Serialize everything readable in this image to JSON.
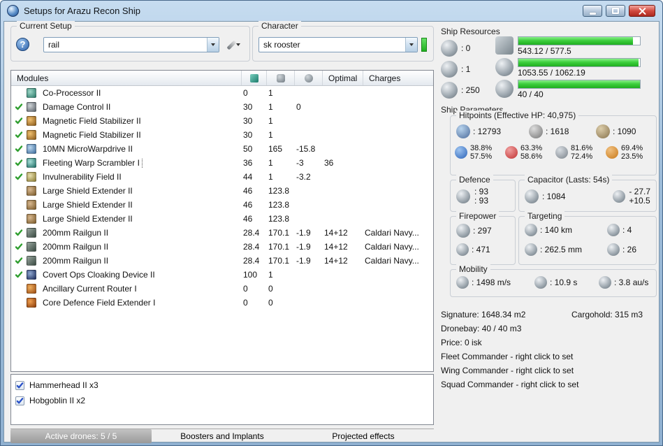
{
  "window": {
    "title": "Setups for Arazu Recon Ship"
  },
  "colors": {
    "progress_green": "#3ecf3e",
    "active_check_green": "#2f9e2f",
    "titlebar_blue": "#9dbcd9",
    "close_button_red": "#d24b40",
    "character_status_green": "#1faf1f"
  },
  "icons": {
    "help": "?"
  },
  "setup": {
    "group_label": "Current Setup",
    "selected": "rail"
  },
  "character": {
    "group_label": "Character",
    "selected": "sk rooster"
  },
  "modules": {
    "headers": {
      "name": "Modules",
      "optimal": "Optimal",
      "charges": "Charges"
    },
    "rows": [
      {
        "active": false,
        "icon": "coprocessor",
        "name": "Co-Processor II",
        "cpu": "0",
        "pg": "1",
        "cap": "",
        "optimal": "",
        "charges": ""
      },
      {
        "active": true,
        "icon": "damage-control",
        "name": "Damage Control II",
        "cpu": "30",
        "pg": "1",
        "cap": "0",
        "optimal": "",
        "charges": ""
      },
      {
        "active": true,
        "icon": "mag-stab",
        "name": "Magnetic Field Stabilizer II",
        "cpu": "30",
        "pg": "1",
        "cap": "",
        "optimal": "",
        "charges": ""
      },
      {
        "active": true,
        "icon": "mag-stab",
        "name": "Magnetic Field Stabilizer II",
        "cpu": "30",
        "pg": "1",
        "cap": "",
        "optimal": "",
        "charges": ""
      },
      {
        "active": true,
        "icon": "mwd",
        "name": "10MN MicroWarpdrive II",
        "cpu": "50",
        "pg": "165",
        "cap": "-15.8",
        "optimal": "",
        "charges": ""
      },
      {
        "active": true,
        "selected": true,
        "icon": "scrambler",
        "name": "Fleeting Warp Scrambler I",
        "cpu": "36",
        "pg": "1",
        "cap": "-3",
        "optimal": "36",
        "charges": ""
      },
      {
        "active": true,
        "icon": "invuln",
        "name": "Invulnerability Field II",
        "cpu": "44",
        "pg": "1",
        "cap": "-3.2",
        "optimal": "",
        "charges": ""
      },
      {
        "active": false,
        "icon": "shield-extender",
        "name": "Large Shield Extender II",
        "cpu": "46",
        "pg": "123.8",
        "cap": "",
        "optimal": "",
        "charges": ""
      },
      {
        "active": false,
        "icon": "shield-extender",
        "name": "Large Shield Extender II",
        "cpu": "46",
        "pg": "123.8",
        "cap": "",
        "optimal": "",
        "charges": ""
      },
      {
        "active": false,
        "icon": "shield-extender",
        "name": "Large Shield Extender II",
        "cpu": "46",
        "pg": "123.8",
        "cap": "",
        "optimal": "",
        "charges": ""
      },
      {
        "active": true,
        "icon": "railgun",
        "name": "200mm Railgun II",
        "cpu": "28.4",
        "pg": "170.1",
        "cap": "-1.9",
        "optimal": "14+12",
        "charges": "Caldari Navy..."
      },
      {
        "active": true,
        "icon": "railgun",
        "name": "200mm Railgun II",
        "cpu": "28.4",
        "pg": "170.1",
        "cap": "-1.9",
        "optimal": "14+12",
        "charges": "Caldari Navy..."
      },
      {
        "active": true,
        "icon": "railgun",
        "name": "200mm Railgun II",
        "cpu": "28.4",
        "pg": "170.1",
        "cap": "-1.9",
        "optimal": "14+12",
        "charges": "Caldari Navy..."
      },
      {
        "active": true,
        "icon": "cloak",
        "name": "Covert Ops Cloaking Device II",
        "cpu": "100",
        "pg": "1",
        "cap": "",
        "optimal": "",
        "charges": ""
      },
      {
        "active": false,
        "icon": "rig-router",
        "name": "Ancillary Current Router I",
        "cpu": "0",
        "pg": "0",
        "cap": "",
        "optimal": "",
        "charges": ""
      },
      {
        "active": false,
        "icon": "rig-shield",
        "name": "Core Defence Field Extender I",
        "cpu": "0",
        "pg": "0",
        "cap": "",
        "optimal": "",
        "charges": ""
      }
    ]
  },
  "drones": {
    "items": [
      {
        "checked": true,
        "label": "Hammerhead II x3"
      },
      {
        "checked": true,
        "label": "Hobgoblin II x2"
      }
    ]
  },
  "tabs": [
    {
      "label": "Active drones: 5 / 5",
      "active": true
    },
    {
      "label": "Boosters and Implants",
      "active": false
    },
    {
      "label": "Projected effects",
      "active": false
    }
  ],
  "resources": {
    "title": "Ship Resources",
    "turrets_free": "0",
    "launchers_free": "1",
    "calibration_free": "250",
    "cpu_text": "543.12 / 577.5",
    "cpu_pct": 94,
    "powergrid_text": "1053.55 / 1062.19",
    "powergrid_pct": 99,
    "drone_bandwidth_text": "40 / 40",
    "drone_bandwidth_pct": 100
  },
  "parameters": {
    "title": "Ship Parameters",
    "hitpoints": {
      "label": "Hitpoints (Effective HP: 40,975)",
      "shield": "12793",
      "armor": "1618",
      "structure": "1090",
      "resists": [
        {
          "icon": "em-resist",
          "shield_resist": "38.8%",
          "armor_resist": "57.5%"
        },
        {
          "icon": "thermal-resist",
          "shield_resist": "63.3%",
          "armor_resist": "58.6%"
        },
        {
          "icon": "kinetic-resist",
          "shield_resist": "81.6%",
          "armor_resist": "72.4%"
        },
        {
          "icon": "explosive-resist",
          "shield_resist": "69.4%",
          "armor_resist": "23.5%"
        }
      ]
    },
    "defence": {
      "label": "Defence",
      "value_top": "93",
      "value_bottom": "93"
    },
    "capacitor": {
      "label": "Capacitor (Lasts: 54s)",
      "amount": "1084",
      "drain": "- 27.7",
      "recharge": "+10.5"
    },
    "firepower": {
      "label": "Firepower",
      "volley": "297",
      "dps": "471"
    },
    "targeting": {
      "label": "Targeting",
      "range": "140 km",
      "max_targets": "4",
      "scan_resolution": "262.5 mm",
      "sensor_strength": "26"
    },
    "mobility": {
      "label": "Mobility",
      "max_velocity": "1498 m/s",
      "align_time": "10.9 s",
      "warp_speed": "3.8 au/s"
    }
  },
  "footer": {
    "signature": "Signature: 1648.34 m2",
    "cargohold": "Cargohold: 315 m3",
    "dronebay": "Dronebay: 40 / 40 m3",
    "price": "Price: 0 isk",
    "fleet_commander": "Fleet Commander - right click to set",
    "wing_commander": "Wing Commander - right click to set",
    "squad_commander": "Squad Commander - right click to set"
  }
}
